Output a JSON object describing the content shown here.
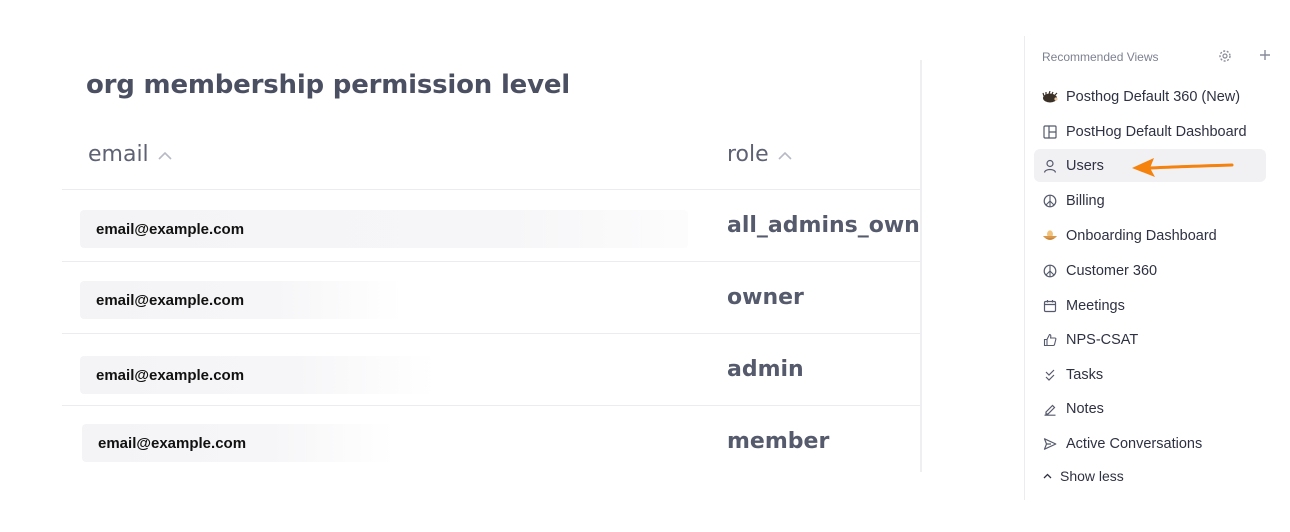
{
  "table": {
    "title": "org membership permission level",
    "columns": [
      {
        "label": "email"
      },
      {
        "label": "role"
      }
    ],
    "rows": [
      {
        "email": "email@example.com",
        "role": "all_admins_owners"
      },
      {
        "email": "email@example.com",
        "role": "owner"
      },
      {
        "email": "email@example.com",
        "role": "admin"
      },
      {
        "email": "email@example.com",
        "role": "member"
      }
    ]
  },
  "sidebar": {
    "title": "Recommended Views",
    "items": [
      {
        "label": "Posthog Default 360 (New)",
        "icon": "hedgehog-emoji-icon"
      },
      {
        "label": "PostHog Default Dashboard",
        "icon": "dashboard-layout-icon"
      },
      {
        "label": "Users",
        "icon": "user-icon",
        "active": true
      },
      {
        "label": "Billing",
        "icon": "peace-icon"
      },
      {
        "label": "Onboarding Dashboard",
        "icon": "nest-egg-emoji-icon"
      },
      {
        "label": "Customer 360",
        "icon": "peace-icon"
      },
      {
        "label": "Meetings",
        "icon": "calendar-icon"
      },
      {
        "label": "NPS-CSAT",
        "icon": "thumbs-up-icon"
      },
      {
        "label": "Tasks",
        "icon": "double-check-icon"
      },
      {
        "label": "Notes",
        "icon": "pen-icon"
      },
      {
        "label": "Active Conversations",
        "icon": "send-icon"
      }
    ],
    "show_less_label": "Show less"
  },
  "colors": {
    "annotation_arrow": "#f5820d",
    "active_item_bg": "#f1f1f4"
  }
}
